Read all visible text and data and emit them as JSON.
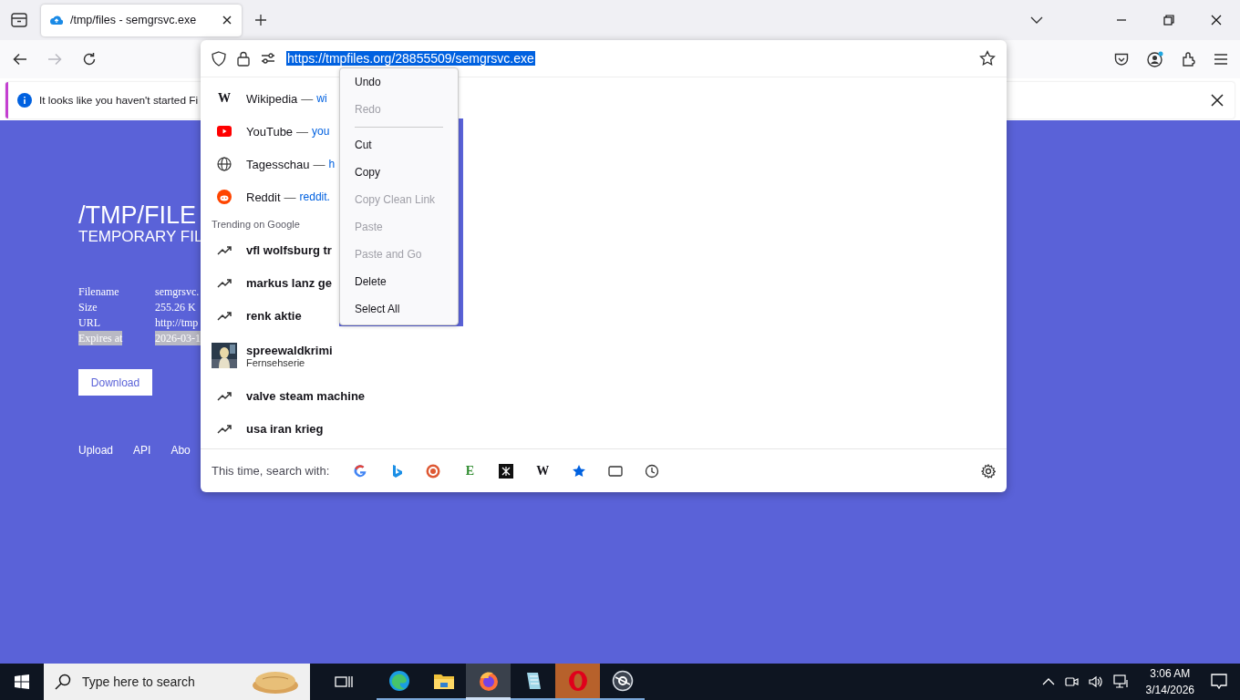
{
  "tab": {
    "title": "/tmp/files - semgrsvc.exe",
    "selected": true
  },
  "nav": {
    "forward_disabled": true
  },
  "notification": {
    "text": "It looks like you haven't started Fi"
  },
  "page": {
    "title": "/TMP/FILE",
    "subtitle": "TEMPORARY FIL",
    "details": [
      {
        "label": "Filename",
        "value": "semgrsvc.",
        "selected": false
      },
      {
        "label": "Size",
        "value": "255.26 K",
        "selected": false
      },
      {
        "label": "URL",
        "value": "http://tmp",
        "selected": false
      },
      {
        "label": "Expires at",
        "value": "2026-03-1",
        "selected": true
      }
    ],
    "download": "Download",
    "links": [
      "Upload",
      "API",
      "Abo"
    ]
  },
  "urlbar": {
    "url": "https://tmpfiles.org/28855509/semgrsvc.exe",
    "selected": true
  },
  "suggestions": [
    {
      "kind": "wikipedia",
      "glyph": "W",
      "title": "Wikipedia",
      "separator": "—",
      "url": "wi"
    },
    {
      "kind": "youtube",
      "title": "YouTube",
      "separator": "—",
      "url": "you"
    },
    {
      "kind": "globe",
      "title": "Tagesschau",
      "separator": "—",
      "url": "h"
    },
    {
      "kind": "reddit",
      "title": "Reddit",
      "separator": "—",
      "url": "reddit."
    }
  ],
  "trending": {
    "heading": "Trending on Google",
    "items": [
      {
        "kind": "trend",
        "text": "vfl wolfsburg tr"
      },
      {
        "kind": "trend",
        "text": "markus lanz ge"
      },
      {
        "kind": "trend",
        "text": "renk aktie"
      },
      {
        "kind": "picture",
        "text": "spreewaldkrimi",
        "subtitle": "Fernsehserie"
      },
      {
        "kind": "trend",
        "text": "valve steam machine"
      },
      {
        "kind": "trend",
        "text": "usa iran krieg"
      }
    ]
  },
  "search_with": {
    "label": "This time, search with:",
    "engines": [
      {
        "kind": "google"
      },
      {
        "kind": "bing"
      },
      {
        "kind": "duckduckgo"
      },
      {
        "kind": "letter",
        "glyph": "E",
        "color": "#2e8b2e"
      },
      {
        "kind": "dark"
      },
      {
        "kind": "serif",
        "glyph": "W"
      },
      {
        "kind": "bookmarks"
      },
      {
        "kind": "tabs"
      },
      {
        "kind": "history"
      }
    ]
  },
  "context_menu": [
    {
      "kind": "item",
      "label": "Undo",
      "disabled": false
    },
    {
      "kind": "item",
      "label": "Redo",
      "disabled": true
    },
    {
      "kind": "separator"
    },
    {
      "kind": "item",
      "label": "Cut",
      "disabled": false
    },
    {
      "kind": "item",
      "label": "Copy",
      "disabled": false
    },
    {
      "kind": "item",
      "label": "Copy Clean Link",
      "disabled": true
    },
    {
      "kind": "item",
      "label": "Paste",
      "disabled": true
    },
    {
      "kind": "item",
      "label": "Paste and Go",
      "disabled": true
    },
    {
      "kind": "item",
      "label": "Delete",
      "disabled": false
    },
    {
      "kind": "item",
      "label": "Select All",
      "disabled": false
    }
  ],
  "taskbar": {
    "search_placeholder": "Type here to search",
    "apps": [
      {
        "kind": "edge",
        "selected": false,
        "flashing": false
      },
      {
        "kind": "explorer",
        "selected": false,
        "flashing": false
      },
      {
        "kind": "firefox",
        "selected": true,
        "flashing": false
      },
      {
        "kind": "notepad",
        "selected": false,
        "flashing": false
      },
      {
        "kind": "opera",
        "selected": false,
        "flashing": true
      },
      {
        "kind": "gear",
        "selected": false,
        "flashing": false
      }
    ],
    "time": "3:06 AM",
    "date": "3/14/2026"
  }
}
